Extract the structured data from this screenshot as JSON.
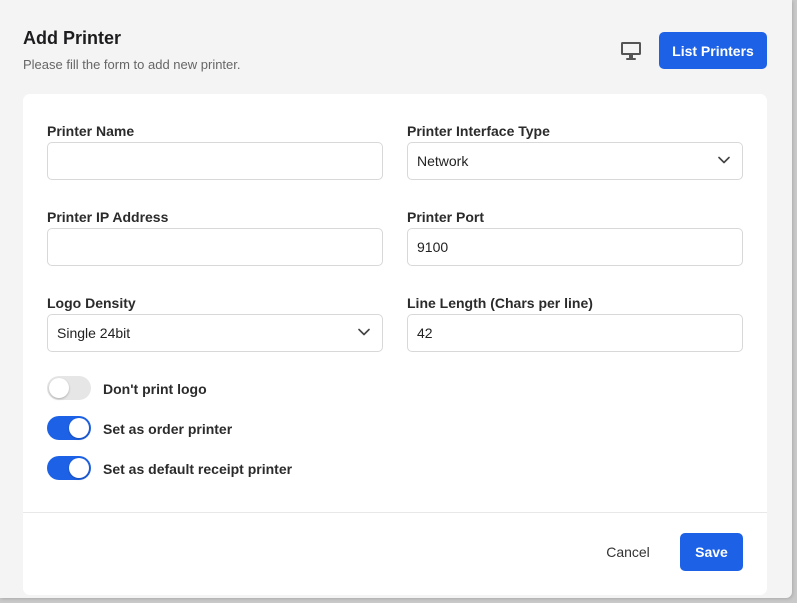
{
  "header": {
    "title": "Add Printer",
    "subtitle": "Please fill the form to add new printer.",
    "list_button": "List Printers",
    "monitor_icon": "monitor-icon"
  },
  "form": {
    "printer_name": {
      "label": "Printer Name",
      "value": ""
    },
    "interface_type": {
      "label": "Printer Interface Type",
      "value": "Network"
    },
    "ip_address": {
      "label": "Printer IP Address",
      "value": ""
    },
    "port": {
      "label": "Printer Port",
      "value": "9100"
    },
    "logo_density": {
      "label": "Logo Density",
      "value": "Single 24bit"
    },
    "line_length": {
      "label": "Line Length (Chars per line)",
      "value": "42"
    }
  },
  "toggles": [
    {
      "label": "Don't print logo",
      "on": false
    },
    {
      "label": "Set as order printer",
      "on": true
    },
    {
      "label": "Set as default receipt printer",
      "on": true
    }
  ],
  "footer": {
    "cancel": "Cancel",
    "save": "Save"
  },
  "colors": {
    "accent": "#1d62e6",
    "toggle_off": "#e6e6e6"
  }
}
